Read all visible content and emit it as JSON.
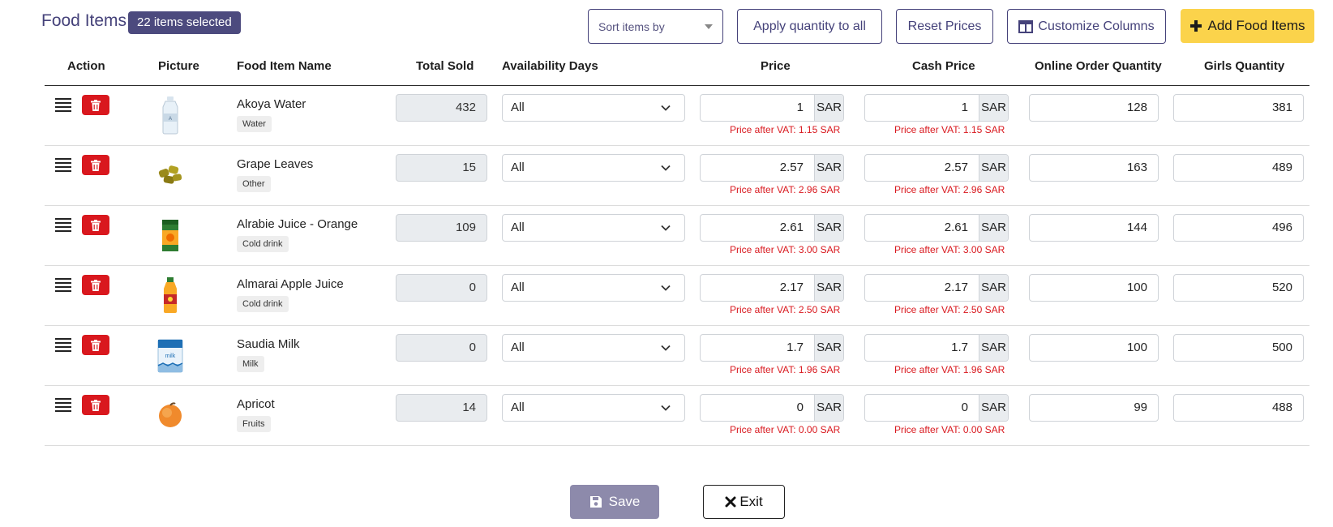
{
  "header": {
    "title": "Food Items",
    "selected_badge": "22 items selected"
  },
  "toolbar": {
    "sort_placeholder": "Sort items by",
    "apply_qty_label": "Apply quantity to all",
    "reset_prices_label": "Reset Prices",
    "customize_label": "Customize Columns",
    "add_label": "Add Food Items"
  },
  "columns": {
    "action": "Action",
    "picture": "Picture",
    "name": "Food Item Name",
    "total_sold": "Total Sold",
    "availability": "Availability Days",
    "price": "Price",
    "cash_price": "Cash Price",
    "online_qty": "Online Order Quantity",
    "girls_qty": "Girls Quantity"
  },
  "rows": [
    {
      "name": "Akoya Water",
      "category": "Water",
      "total_sold": "432",
      "availability": "All",
      "price": "1",
      "price_currency": "SAR",
      "price_vat": "Price after VAT: 1.15 SAR",
      "cash_price": "1",
      "cash_currency": "SAR",
      "cash_vat": "Price after VAT: 1.15 SAR",
      "online_qty": "128",
      "girls_qty": "381",
      "picture_icon": "water-bottle-icon"
    },
    {
      "name": "Grape Leaves",
      "category": "Other",
      "total_sold": "15",
      "availability": "All",
      "price": "2.57",
      "price_currency": "SAR",
      "price_vat": "Price after VAT: 2.96 SAR",
      "cash_price": "2.57",
      "cash_currency": "SAR",
      "cash_vat": "Price after VAT: 2.96 SAR",
      "online_qty": "163",
      "girls_qty": "489",
      "picture_icon": "grape-leaves-icon"
    },
    {
      "name": "Alrabie Juice - Orange",
      "category": "Cold drink",
      "total_sold": "109",
      "availability": "All",
      "price": "2.61",
      "price_currency": "SAR",
      "price_vat": "Price after VAT: 3.00 SAR",
      "cash_price": "2.61",
      "cash_currency": "SAR",
      "cash_vat": "Price after VAT: 3.00 SAR",
      "online_qty": "144",
      "girls_qty": "496",
      "picture_icon": "juice-box-icon"
    },
    {
      "name": "Almarai Apple Juice",
      "category": "Cold drink",
      "total_sold": "0",
      "availability": "All",
      "price": "2.17",
      "price_currency": "SAR",
      "price_vat": "Price after VAT: 2.50 SAR",
      "cash_price": "2.17",
      "cash_currency": "SAR",
      "cash_vat": "Price after VAT: 2.50 SAR",
      "online_qty": "100",
      "girls_qty": "520",
      "picture_icon": "juice-bottle-icon"
    },
    {
      "name": "Saudia Milk",
      "category": "Milk",
      "total_sold": "0",
      "availability": "All",
      "price": "1.7",
      "price_currency": "SAR",
      "price_vat": "Price after VAT: 1.96 SAR",
      "cash_price": "1.7",
      "cash_currency": "SAR",
      "cash_vat": "Price after VAT: 1.96 SAR",
      "online_qty": "100",
      "girls_qty": "500",
      "picture_icon": "milk-carton-icon"
    },
    {
      "name": "Apricot",
      "category": "Fruits",
      "total_sold": "14",
      "availability": "All",
      "price": "0",
      "price_currency": "SAR",
      "price_vat": "Price after VAT: 0.00 SAR",
      "cash_price": "0",
      "cash_currency": "SAR",
      "cash_vat": "Price after VAT: 0.00 SAR",
      "online_qty": "99",
      "girls_qty": "488",
      "picture_icon": "apricot-icon"
    }
  ],
  "footer": {
    "save_label": "Save",
    "exit_label": "Exit"
  },
  "colors": {
    "brand": "#45427a",
    "badge": "#4c4a7e",
    "add_button": "#fbd34b",
    "delete_button": "#d9181e",
    "vat_text": "#d9181e",
    "save_button": "#8d8aab"
  }
}
